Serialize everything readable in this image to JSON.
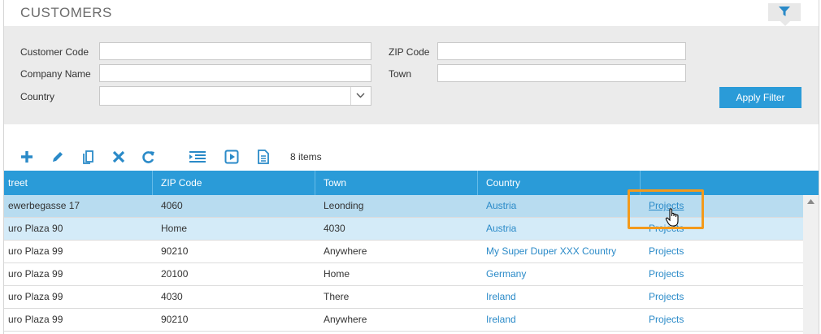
{
  "app": {
    "title": "CUSTOMERS"
  },
  "filter": {
    "customer_code_label": "Customer Code",
    "company_name_label": "Company Name",
    "country_label": "Country",
    "zip_label": "ZIP Code",
    "town_label": "Town",
    "customer_code_value": "",
    "company_name_value": "",
    "country_value": "",
    "zip_value": "",
    "town_value": "",
    "apply_label": "Apply Filter"
  },
  "toolbar": {
    "icons": [
      "add-icon",
      "edit-icon",
      "copy-icon",
      "delete-icon",
      "refresh-icon",
      "list-view-icon",
      "play-icon",
      "document-icon"
    ],
    "item_count": "8 items"
  },
  "grid": {
    "columns": [
      "treet",
      "ZIP Code",
      "Town",
      "Country",
      ""
    ],
    "rows": [
      {
        "street": "ewerbegasse 17",
        "zip": "4060",
        "town": "Leonding",
        "country": "Austria",
        "projects": "Projects"
      },
      {
        "street": "uro Plaza 90",
        "zip": "Home",
        "town": "4030",
        "country": "Austria",
        "projects": "Projects"
      },
      {
        "street": "uro Plaza 99",
        "zip": "90210",
        "town": "Anywhere",
        "country": "My Super Duper XXX Country",
        "projects": "Projects"
      },
      {
        "street": "uro Plaza 99",
        "zip": "20100",
        "town": "Home",
        "country": "Germany",
        "projects": "Projects"
      },
      {
        "street": "uro Plaza 99",
        "zip": "4030",
        "town": "There",
        "country": "Ireland",
        "projects": "Projects"
      },
      {
        "street": "uro Plaza 99",
        "zip": "90210",
        "town": "Anywhere",
        "country": "Ireland",
        "projects": "Projects"
      }
    ]
  },
  "colors": {
    "accent": "#2a9bd8",
    "selected_row": "#b8dcf0",
    "hover_row": "#d4ebf8",
    "highlight": "#f39a1c"
  }
}
